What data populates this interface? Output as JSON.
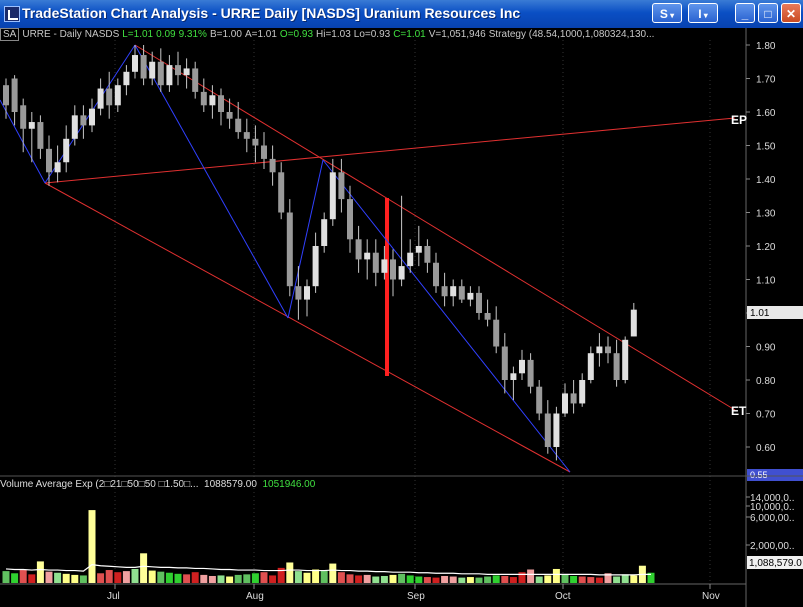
{
  "window": {
    "title": "TradeStation Chart Analysis - URRE Daily [NASDS] Uranium Resources Inc",
    "buttons": {
      "s": "S",
      "i": "I",
      "minimize": "_",
      "maximize": "□",
      "close": "✕"
    }
  },
  "header": {
    "sa": "SA",
    "symbol": "URRE - Daily",
    "exchange": "NASDS",
    "last": "L=1.01",
    "change": "0.09",
    "change_pct": "9.31%",
    "bid": "B=1.00",
    "ask": "A=1.01",
    "open": "O=0.93",
    "high": "Hi=1.03",
    "low": "Lo=0.93",
    "close": "C=1.01",
    "volume": "V=1,051,946",
    "strategy": "Strategy (48.54,1000,1,080324,130..."
  },
  "price_axis": {
    "ticks": [
      "1.80",
      "1.70",
      "1.60",
      "1.50",
      "1.40",
      "1.30",
      "1.20",
      "1.10",
      "1.00",
      "0.90",
      "0.80",
      "0.70",
      "0.60"
    ],
    "current_price_label": "1.01",
    "lower_box_label": "0.55"
  },
  "annotations": {
    "upper_label": "EP",
    "lower_label": "ET"
  },
  "volume_panel": {
    "indicator": "Volume Average Exp (2□21□50□50 □1.50□...",
    "value1": "1088579.00",
    "value2": "1051946.00",
    "axis_ticks": [
      "14,000,0..",
      "10,000,0..",
      "6,000,00..",
      "2,000,00.."
    ],
    "current_label": "1,088,579.0"
  },
  "date_axis": {
    "labels": [
      "Jul",
      "Aug",
      "Sep",
      "Oct",
      "Nov"
    ]
  },
  "chart_data": {
    "type": "bar",
    "symbol": "URRE",
    "interval": "Daily",
    "y_range": [
      0.54,
      1.84
    ],
    "x_labels": [
      "Jul",
      "Aug",
      "Sep",
      "Oct",
      "Nov"
    ],
    "bars": [
      [
        1.68,
        1.7,
        1.58,
        1.62
      ],
      [
        1.7,
        1.71,
        1.56,
        1.6
      ],
      [
        1.62,
        1.64,
        1.48,
        1.55
      ],
      [
        1.55,
        1.6,
        1.45,
        1.57
      ],
      [
        1.57,
        1.59,
        1.46,
        1.49
      ],
      [
        1.49,
        1.53,
        1.38,
        1.42
      ],
      [
        1.42,
        1.5,
        1.39,
        1.45
      ],
      [
        1.45,
        1.56,
        1.42,
        1.52
      ],
      [
        1.52,
        1.62,
        1.5,
        1.59
      ],
      [
        1.59,
        1.62,
        1.52,
        1.56
      ],
      [
        1.56,
        1.64,
        1.54,
        1.61
      ],
      [
        1.61,
        1.7,
        1.59,
        1.67
      ],
      [
        1.67,
        1.72,
        1.58,
        1.62
      ],
      [
        1.62,
        1.7,
        1.6,
        1.68
      ],
      [
        1.68,
        1.74,
        1.65,
        1.72
      ],
      [
        1.72,
        1.8,
        1.7,
        1.77
      ],
      [
        1.77,
        1.8,
        1.68,
        1.7
      ],
      [
        1.7,
        1.78,
        1.68,
        1.75
      ],
      [
        1.75,
        1.79,
        1.66,
        1.68
      ],
      [
        1.68,
        1.77,
        1.66,
        1.74
      ],
      [
        1.74,
        1.78,
        1.68,
        1.71
      ],
      [
        1.71,
        1.76,
        1.67,
        1.73
      ],
      [
        1.73,
        1.75,
        1.64,
        1.66
      ],
      [
        1.66,
        1.7,
        1.6,
        1.62
      ],
      [
        1.62,
        1.68,
        1.58,
        1.65
      ],
      [
        1.65,
        1.67,
        1.56,
        1.6
      ],
      [
        1.6,
        1.64,
        1.55,
        1.58
      ],
      [
        1.58,
        1.63,
        1.52,
        1.54
      ],
      [
        1.54,
        1.58,
        1.48,
        1.52
      ],
      [
        1.52,
        1.56,
        1.45,
        1.5
      ],
      [
        1.5,
        1.54,
        1.43,
        1.46
      ],
      [
        1.46,
        1.5,
        1.38,
        1.42
      ],
      [
        1.42,
        1.45,
        1.28,
        1.3
      ],
      [
        1.3,
        1.34,
        1.05,
        1.08
      ],
      [
        1.08,
        1.14,
        0.98,
        1.04
      ],
      [
        1.04,
        1.1,
        0.99,
        1.08
      ],
      [
        1.08,
        1.24,
        1.06,
        1.2
      ],
      [
        1.2,
        1.3,
        1.18,
        1.28
      ],
      [
        1.28,
        1.46,
        1.26,
        1.42
      ],
      [
        1.42,
        1.46,
        1.3,
        1.34
      ],
      [
        1.34,
        1.38,
        1.18,
        1.22
      ],
      [
        1.22,
        1.26,
        1.12,
        1.16
      ],
      [
        1.16,
        1.22,
        1.1,
        1.18
      ],
      [
        1.18,
        1.22,
        1.08,
        1.12
      ],
      [
        1.12,
        1.2,
        1.1,
        1.16
      ],
      [
        1.16,
        1.19,
        1.05,
        1.1
      ],
      [
        1.1,
        1.35,
        1.08,
        1.14
      ],
      [
        1.14,
        1.22,
        1.12,
        1.18
      ],
      [
        1.18,
        1.26,
        1.14,
        1.2
      ],
      [
        1.2,
        1.22,
        1.12,
        1.15
      ],
      [
        1.15,
        1.18,
        1.06,
        1.08
      ],
      [
        1.08,
        1.12,
        1.02,
        1.05
      ],
      [
        1.05,
        1.1,
        1.02,
        1.08
      ],
      [
        1.08,
        1.1,
        1.03,
        1.04
      ],
      [
        1.04,
        1.08,
        1.02,
        1.06
      ],
      [
        1.06,
        1.08,
        0.98,
        1.0
      ],
      [
        1.0,
        1.04,
        0.96,
        0.98
      ],
      [
        0.98,
        1.02,
        0.88,
        0.9
      ],
      [
        0.9,
        0.94,
        0.76,
        0.8
      ],
      [
        0.8,
        0.84,
        0.74,
        0.82
      ],
      [
        0.82,
        0.89,
        0.8,
        0.86
      ],
      [
        0.86,
        0.88,
        0.76,
        0.78
      ],
      [
        0.78,
        0.8,
        0.68,
        0.7
      ],
      [
        0.7,
        0.74,
        0.58,
        0.6
      ],
      [
        0.6,
        0.72,
        0.56,
        0.7
      ],
      [
        0.7,
        0.79,
        0.69,
        0.76
      ],
      [
        0.76,
        0.8,
        0.7,
        0.73
      ],
      [
        0.73,
        0.82,
        0.72,
        0.8
      ],
      [
        0.8,
        0.9,
        0.79,
        0.88
      ],
      [
        0.88,
        0.94,
        0.84,
        0.9
      ],
      [
        0.9,
        0.93,
        0.85,
        0.88
      ],
      [
        0.88,
        0.92,
        0.78,
        0.8
      ],
      [
        0.8,
        0.93,
        0.79,
        0.92
      ],
      [
        0.93,
        1.03,
        0.93,
        1.01
      ]
    ],
    "volume": [
      2.2,
      1.8,
      2.5,
      1.6,
      4.0,
      2.1,
      1.9,
      1.7,
      1.5,
      1.4,
      13.5,
      1.8,
      2.4,
      2.0,
      2.2,
      2.6,
      5.5,
      2.3,
      2.1,
      1.9,
      1.7,
      1.6,
      2.0,
      1.5,
      1.3,
      1.4,
      1.2,
      1.5,
      1.6,
      1.8,
      2.0,
      1.4,
      2.8,
      3.8,
      2.2,
      1.9,
      2.5,
      2.4,
      3.6,
      2.0,
      1.6,
      1.4,
      1.5,
      1.2,
      1.3,
      1.5,
      1.7,
      1.4,
      1.2,
      1.1,
      1.0,
      1.3,
      1.2,
      1.0,
      1.1,
      1.0,
      1.2,
      1.4,
      1.3,
      1.1,
      2.0,
      2.5,
      1.2,
      1.4,
      2.6,
      1.5,
      1.3,
      1.2,
      1.1,
      1.0,
      1.8,
      1.2,
      1.6,
      1.4,
      3.2,
      1.9
    ],
    "volume_average": [
      2.6,
      2.5,
      2.5,
      2.4,
      2.5,
      2.4,
      2.4,
      2.3,
      2.3,
      2.2,
      3.4,
      3.2,
      3.1,
      3.0,
      2.9,
      2.9,
      3.1,
      3.0,
      2.9,
      2.9,
      2.8,
      2.8,
      2.7,
      2.7,
      2.6,
      2.5,
      2.5,
      2.4,
      2.4,
      2.4,
      2.3,
      2.3,
      2.3,
      2.4,
      2.4,
      2.3,
      2.3,
      2.3,
      2.4,
      2.3,
      2.3,
      2.2,
      2.2,
      2.1,
      2.1,
      2.0,
      2.0,
      2.0,
      1.9,
      1.9,
      1.8,
      1.8,
      1.8,
      1.7,
      1.7,
      1.7,
      1.6,
      1.6,
      1.6,
      1.6,
      1.6,
      1.6,
      1.6,
      1.6,
      1.6,
      1.6,
      1.6,
      1.6,
      1.6,
      1.5,
      1.5,
      1.5,
      1.5,
      1.5,
      1.6,
      1.6
    ]
  }
}
